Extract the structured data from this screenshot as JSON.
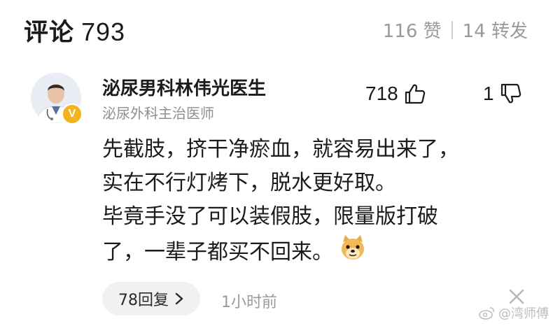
{
  "header": {
    "title": "评论",
    "comment_count": "793",
    "likes": "116 赞",
    "reposts": "14 转发"
  },
  "comment": {
    "author": "泌尿男科林伟光医生",
    "author_title": "泌尿外科主治医师",
    "verified_badge": "V",
    "like_count": "718",
    "dislike_count": "1",
    "lines": [
      "先截肢，挤干净瘀血，就容易出来了，",
      "实在不行灯烤下，脱水更好取。",
      "毕竟手没了可以装假肢，限量版打破",
      "了，一辈子都买不回来。"
    ],
    "emoji": "doge-emoji",
    "reply_label": "78回复",
    "time": "1小时前"
  },
  "watermark": "@湾师傅",
  "colors": {
    "badge": "#f2b31d",
    "muted": "#9a9a9a",
    "reply_bg": "#f1f1f1"
  },
  "icons": {
    "like": "thumbs-up-icon",
    "dislike": "thumbs-down-icon",
    "close": "close-icon",
    "reply_chevron": "chevron-right-icon",
    "watermark": "weibo-logo-icon"
  }
}
